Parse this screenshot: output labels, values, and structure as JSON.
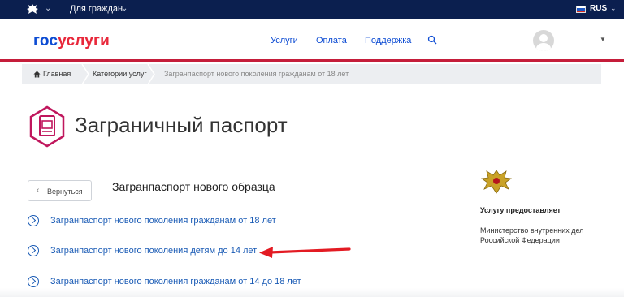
{
  "topbar": {
    "citizens_label": "Для граждан",
    "lang": "RUS"
  },
  "header": {
    "logo_part1": "гос",
    "logo_part2": "услуги",
    "nav": [
      "Услуги",
      "Оплата",
      "Поддержка"
    ]
  },
  "breadcrumb": {
    "items": [
      "Главная",
      "Категории услуг",
      "Загранпаспорт нового поколения гражданам от 18 лет"
    ]
  },
  "page": {
    "title": "Заграничный паспорт",
    "back_label": "Вернуться",
    "section_title": "Загранпаспорт нового образца",
    "links": [
      "Загранпаспорт нового поколения гражданам от 18 лет",
      "Загранпаспорт нового поколения детям до 14 лет",
      "Загранпаспорт нового поколения гражданам от 14 до 18 лет"
    ]
  },
  "provider": {
    "title": "Услугу предоставляет",
    "name": "Министерство внутренних дел Российской Федерации"
  },
  "colors": {
    "topbar": "#0b1f4f",
    "accent_red": "#c51d3a",
    "link_blue": "#1a5bb5",
    "passport_icon": "#c0175d",
    "arrow": "#e31b23"
  },
  "icons": {
    "emblem": "russia-coat-of-arms-icon",
    "search": "search-icon",
    "home": "home-icon",
    "passport": "passport-icon",
    "link": "chevron-circle-icon"
  }
}
